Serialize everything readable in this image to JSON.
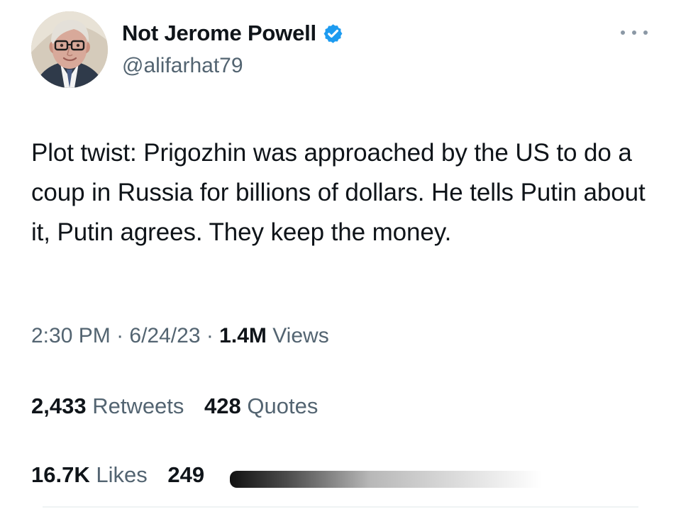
{
  "author": {
    "display_name": "Not Jerome Powell",
    "handle": "@alifarhat79",
    "verified": true
  },
  "post": {
    "text": "Plot twist: Prigozhin was approached by the US to do a coup in Russia for billions of dollars. He tells Putin about it, Putin agrees. They keep the money."
  },
  "meta": {
    "time": "2:30 PM",
    "separator_1": " · ",
    "date": "6/24/23",
    "separator_2": " · ",
    "views_count": "1.4M",
    "views_label": " Views"
  },
  "engagement": {
    "retweets_count": "2,433",
    "retweets_label": " Retweets",
    "quotes_count": "428",
    "quotes_label": " Quotes",
    "likes_count": "16.7K",
    "likes_label": " Likes",
    "bookmarks_partial": "249"
  },
  "icons": {
    "avatar": "profile-photo-man-glasses",
    "verified": "verified-badge-icon",
    "more": "more-horizontal-icon"
  },
  "colors": {
    "primary_text": "#0f1419",
    "secondary_text": "#536471",
    "verified_blue": "#1d9bf0",
    "background": "#ffffff"
  }
}
